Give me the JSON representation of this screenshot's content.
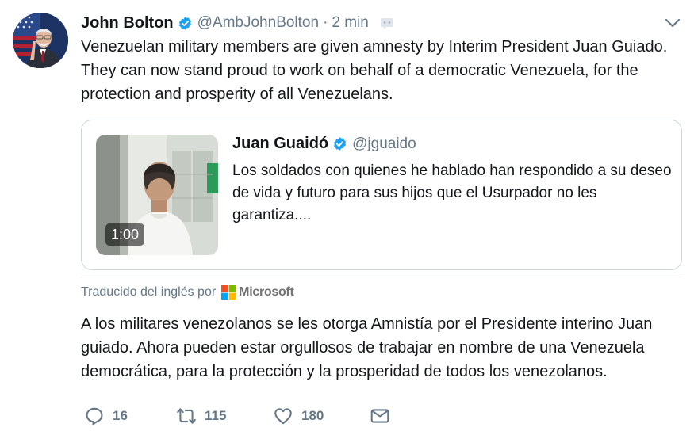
{
  "tweet": {
    "author": {
      "name": "John Bolton",
      "handle": "@AmbJohnBolton",
      "verified": true
    },
    "time": "2 min",
    "dot": "·",
    "text": "Venezuelan military members are given amnesty by Interim President Juan Guiado. They can now stand proud to work on behalf of a democratic Venezuela, for the protection and prosperity of all Venezuelans."
  },
  "quote": {
    "author": {
      "name": "Juan Guaidó",
      "handle": "@jguaido",
      "verified": true
    },
    "text": "Los soldados con quienes he hablado han respondido a su deseo de vida y futuro para sus hijos que el Usurpador no les garantiza....",
    "video_duration": "1:00"
  },
  "translation": {
    "label": "Traducido del inglés por",
    "provider": "Microsoft",
    "text": "A los militares venezolanos se les otorga Amnistía por el Presidente interino Juan guiado. Ahora pueden estar orgullosos de trabajar en nombre de una Venezuela democrática, para la protección y la prosperidad de todos los venezolanos."
  },
  "actions": {
    "replies": "16",
    "retweets": "115",
    "likes": "180"
  },
  "colors": {
    "verified_blue": "#1da1f2",
    "secondary_text": "#657786",
    "border": "#ccd6dd"
  }
}
